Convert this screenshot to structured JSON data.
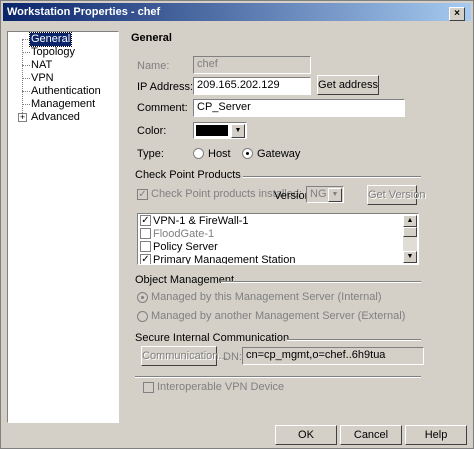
{
  "window": {
    "title": "Workstation Properties - chef",
    "close_glyph": "×"
  },
  "tree": {
    "items": [
      {
        "label": "General"
      },
      {
        "label": "Topology"
      },
      {
        "label": "NAT"
      },
      {
        "label": "VPN"
      },
      {
        "label": "Authentication"
      },
      {
        "label": "Management"
      },
      {
        "label": "Advanced",
        "expandable": true
      }
    ],
    "selected": "General",
    "expander_glyph": "+"
  },
  "general": {
    "heading": "General",
    "name_label": "Name:",
    "name_value": "chef",
    "ip_label": "IP Address:",
    "ip_value": "209.165.202.129",
    "get_address_label": "Get address",
    "comment_label": "Comment:",
    "comment_value": "CP_Server",
    "color_label": "Color:",
    "color_value": "#000000",
    "type_label": "Type:",
    "type_host": "Host",
    "type_gateway": "Gateway",
    "type_selected": "Gateway"
  },
  "check_point": {
    "group_title": "Check Point Products",
    "installed_label": "Check Point products installed:",
    "installed_checked": true,
    "version_label": "Version",
    "version_value": "NG",
    "get_version_label": "Get Version",
    "products": [
      {
        "label": "VPN-1 & FireWall-1",
        "checked": true,
        "enabled": true
      },
      {
        "label": "FloodGate-1",
        "checked": false,
        "enabled": false
      },
      {
        "label": "Policy Server",
        "checked": false,
        "enabled": true
      },
      {
        "label": "Primary Management Station",
        "checked": true,
        "enabled": true
      }
    ],
    "check_glyph": "✓",
    "scroll_up_glyph": "▲",
    "scroll_down_glyph": "▼"
  },
  "object_management": {
    "group_title": "Object Management",
    "internal_label": "Managed by this Management Server (Internal)",
    "external_label": "Managed by another Management Server (External)",
    "selected": "internal"
  },
  "sic": {
    "group_title": "Secure Internal Communication",
    "communication_label": "Communication...",
    "dn_label": "DN:",
    "dn_value": "cn=cp_mgmt,o=chef..6h9tua"
  },
  "vpn_device": {
    "label": "Interoperable VPN Device",
    "checked": false
  },
  "buttons": {
    "ok": "OK",
    "cancel": "Cancel",
    "help": "Help"
  },
  "combo_arrow_glyph": "▼"
}
